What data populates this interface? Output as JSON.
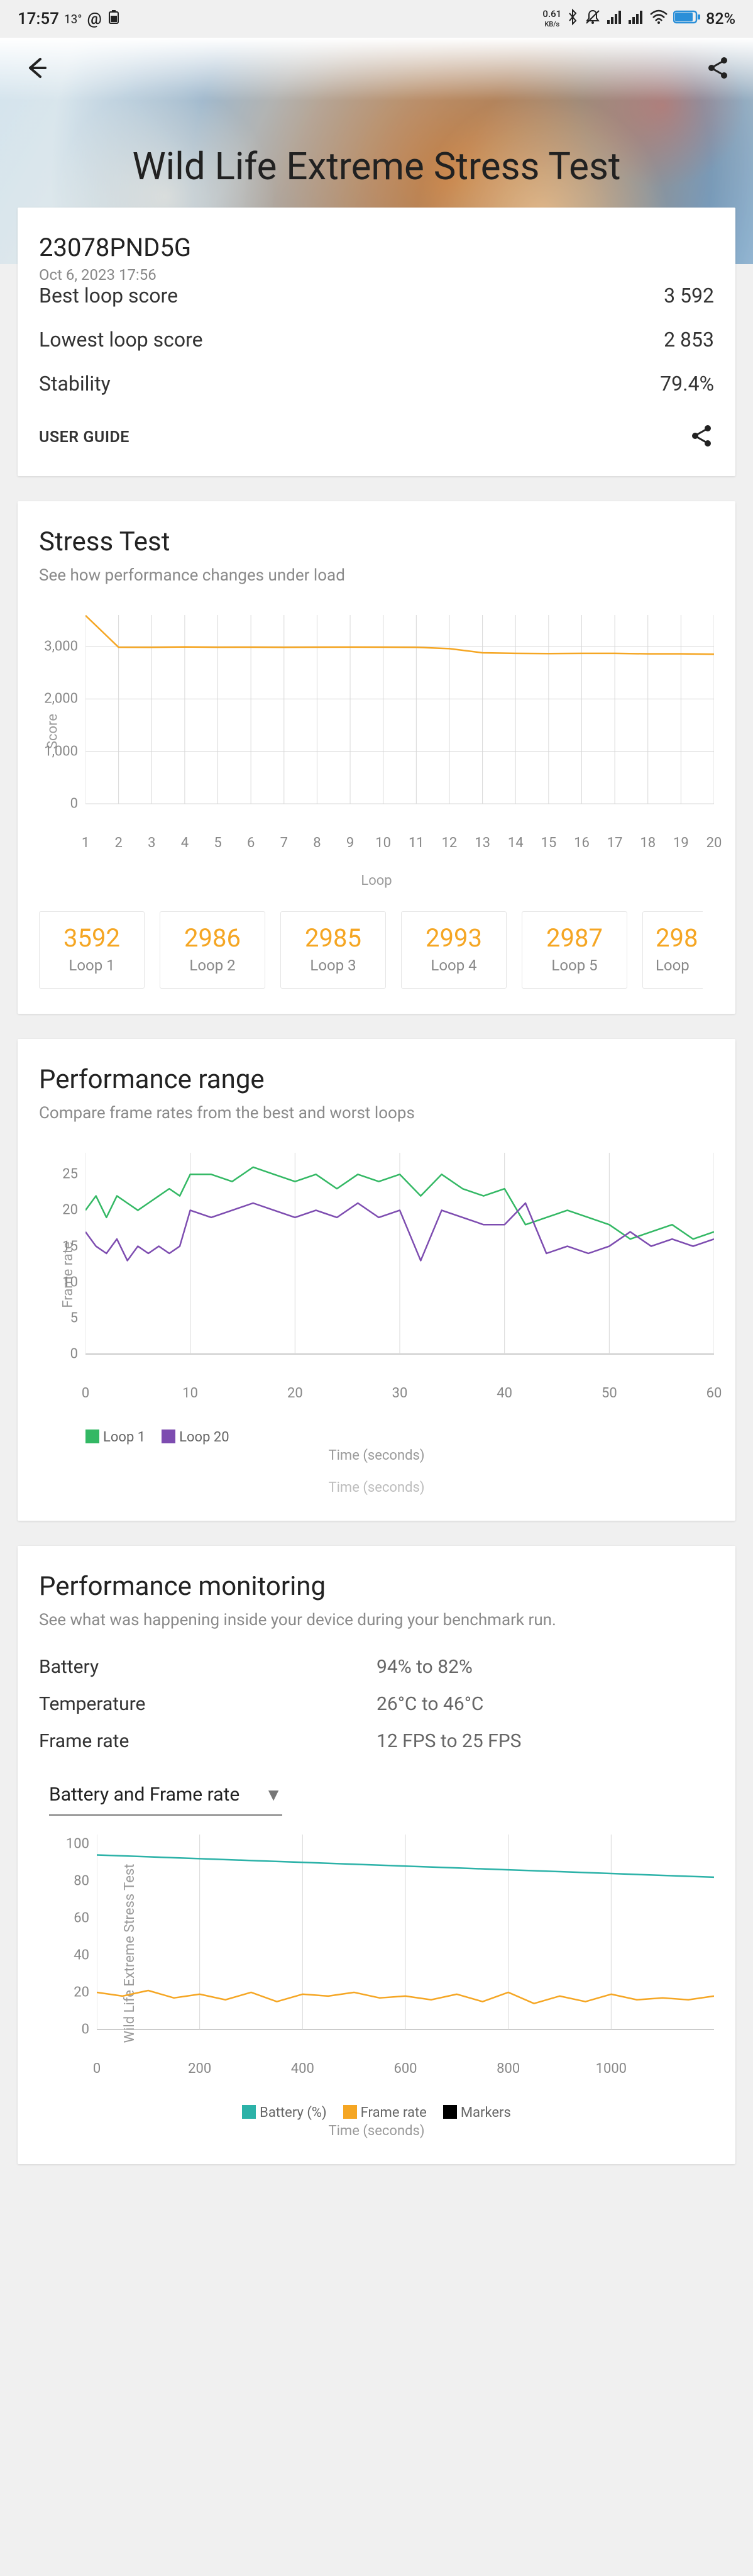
{
  "status": {
    "time": "17:57",
    "temp": "13°",
    "kb_val": "0.61",
    "kb_unit": "KB/s",
    "battery_pct": "82%"
  },
  "hero": {
    "title": "Wild Life Extreme Stress Test"
  },
  "summary": {
    "device": "23078PND5G",
    "timestamp": "Oct 6, 2023 17:56",
    "best_label": "Best loop score",
    "best_val": "3 592",
    "low_label": "Lowest loop score",
    "low_val": "2 853",
    "stab_label": "Stability",
    "stab_val": "79.4%",
    "guide": "USER GUIDE"
  },
  "stress": {
    "title": "Stress Test",
    "sub": "See how performance changes under load",
    "xlabel": "Loop",
    "ylabel": "Score",
    "loops": [
      {
        "label": "Loop 1",
        "score": "3592"
      },
      {
        "label": "Loop 2",
        "score": "2986"
      },
      {
        "label": "Loop 3",
        "score": "2985"
      },
      {
        "label": "Loop 4",
        "score": "2993"
      },
      {
        "label": "Loop 5",
        "score": "2987"
      },
      {
        "label": "Loop",
        "score": "298"
      }
    ]
  },
  "range": {
    "title": "Performance range",
    "sub": "Compare frame rates from the best and worst loops",
    "xlabel": "Time (seconds)",
    "xlabel_faded": "Time (seconds)",
    "ylabel": "Frame rate",
    "legend": {
      "a": "Loop 1",
      "b": "Loop 20"
    }
  },
  "mon": {
    "title": "Performance monitoring",
    "sub": "See what was happening inside your device during your benchmark run.",
    "rows": [
      {
        "k": "Battery",
        "v": "94% to 82%"
      },
      {
        "k": "Temperature",
        "v": "26°C to 46°C"
      },
      {
        "k": "Frame rate",
        "v": "12 FPS to 25 FPS"
      }
    ],
    "dropdown": "Battery and Frame rate",
    "xlabel": "Time (seconds)",
    "ylabel": "Wild Life Extreme Stress Test",
    "legend": {
      "a": "Battery (%)",
      "b": "Frame rate",
      "c": "Markers"
    }
  },
  "chart_data": [
    {
      "type": "line",
      "title": "Stress Test",
      "xlabel": "Loop",
      "ylabel": "Score",
      "ylim": [
        0,
        3600
      ],
      "yticks": [
        0,
        1000,
        2000,
        3000
      ],
      "xlim": [
        1,
        20
      ],
      "xticks": [
        1,
        2,
        3,
        4,
        5,
        6,
        7,
        8,
        9,
        10,
        11,
        12,
        13,
        14,
        15,
        16,
        17,
        18,
        19,
        20
      ],
      "series": [
        {
          "name": "Score",
          "color": "#f5a623",
          "x": [
            1,
            2,
            3,
            4,
            5,
            6,
            7,
            8,
            9,
            10,
            11,
            12,
            13,
            14,
            15,
            16,
            17,
            18,
            19,
            20
          ],
          "values": [
            3592,
            2986,
            2985,
            2993,
            2987,
            2988,
            2985,
            2988,
            2990,
            2988,
            2985,
            2960,
            2880,
            2870,
            2865,
            2870,
            2870,
            2860,
            2860,
            2853
          ]
        }
      ]
    },
    {
      "type": "line",
      "title": "Performance range",
      "xlabel": "Time (seconds)",
      "ylabel": "Frame rate",
      "xlim": [
        0,
        60
      ],
      "xticks": [
        0,
        10,
        20,
        30,
        40,
        50,
        60
      ],
      "ylim": [
        0,
        28
      ],
      "yticks": [
        0,
        5,
        10,
        15,
        20,
        25
      ],
      "series": [
        {
          "name": "Loop 1",
          "color": "#33b864",
          "x": [
            0,
            1,
            2,
            3,
            4,
            5,
            6,
            7,
            8,
            9,
            10,
            12,
            14,
            16,
            18,
            20,
            22,
            24,
            26,
            28,
            30,
            32,
            34,
            36,
            38,
            40,
            42,
            44,
            46,
            48,
            50,
            52,
            54,
            56,
            58,
            60
          ],
          "values": [
            20,
            22,
            19,
            22,
            21,
            20,
            21,
            22,
            23,
            22,
            25,
            25,
            24,
            26,
            25,
            24,
            25,
            23,
            25,
            24,
            25,
            22,
            25,
            23,
            22,
            23,
            18,
            19,
            20,
            19,
            18,
            16,
            17,
            18,
            16,
            17
          ]
        },
        {
          "name": "Loop 20",
          "color": "#7d4cb0",
          "x": [
            0,
            1,
            2,
            3,
            4,
            5,
            6,
            7,
            8,
            9,
            10,
            12,
            14,
            16,
            18,
            20,
            22,
            24,
            26,
            28,
            30,
            32,
            34,
            36,
            38,
            40,
            42,
            44,
            46,
            48,
            50,
            52,
            54,
            56,
            58,
            60
          ],
          "values": [
            17,
            15,
            14,
            16,
            13,
            15,
            14,
            15,
            14,
            15,
            20,
            19,
            20,
            21,
            20,
            19,
            20,
            19,
            21,
            19,
            20,
            13,
            20,
            19,
            18,
            18,
            21,
            14,
            15,
            14,
            15,
            17,
            15,
            16,
            15,
            16
          ]
        }
      ]
    },
    {
      "type": "line",
      "title": "Battery and Frame rate",
      "xlabel": "Time (seconds)",
      "ylabel": "Wild Life Extreme Stress Test",
      "xlim": [
        0,
        1200
      ],
      "xticks": [
        0,
        200,
        400,
        600,
        800,
        1000
      ],
      "ylim": [
        0,
        105
      ],
      "yticks": [
        0,
        20,
        40,
        60,
        80,
        100
      ],
      "series": [
        {
          "name": "Battery (%)",
          "color": "#2cb2a8",
          "x": [
            0,
            100,
            200,
            300,
            400,
            500,
            600,
            700,
            800,
            900,
            1000,
            1100,
            1200
          ],
          "values": [
            94,
            93,
            92,
            91,
            90,
            89,
            88,
            87,
            86,
            85,
            84,
            83,
            82
          ]
        },
        {
          "name": "Frame rate",
          "color": "#f5a623",
          "x": [
            0,
            50,
            100,
            150,
            200,
            250,
            300,
            350,
            400,
            450,
            500,
            550,
            600,
            650,
            700,
            750,
            800,
            850,
            900,
            950,
            1000,
            1050,
            1100,
            1150,
            1200
          ],
          "values": [
            20,
            18,
            21,
            17,
            19,
            16,
            20,
            15,
            19,
            18,
            20,
            17,
            18,
            16,
            19,
            15,
            20,
            14,
            18,
            15,
            19,
            16,
            17,
            16,
            18
          ]
        },
        {
          "name": "Markers",
          "color": "#000000",
          "x": [],
          "values": []
        }
      ]
    }
  ]
}
